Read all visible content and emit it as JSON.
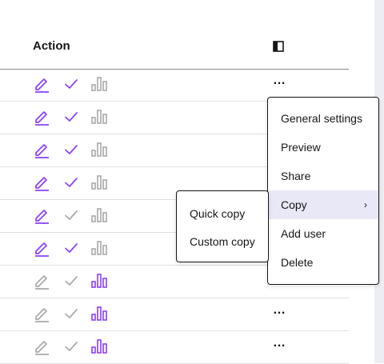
{
  "header": {
    "action_label": "Action"
  },
  "rows": [
    {
      "edit": "active",
      "check": "active",
      "chart": "inactive",
      "overflow": "…"
    },
    {
      "edit": "active",
      "check": "active",
      "chart": "inactive",
      "overflow": ""
    },
    {
      "edit": "active",
      "check": "active",
      "chart": "inactive",
      "overflow": ""
    },
    {
      "edit": "active",
      "check": "active",
      "chart": "inactive",
      "overflow": ""
    },
    {
      "edit": "active",
      "check": "inactive",
      "chart": "inactive",
      "overflow": ""
    },
    {
      "edit": "active",
      "check": "active",
      "chart": "inactive",
      "overflow": ""
    },
    {
      "edit": "inactive",
      "check": "inactive",
      "chart": "active",
      "overflow": ""
    },
    {
      "edit": "inactive",
      "check": "inactive",
      "chart": "active",
      "overflow": "…"
    },
    {
      "edit": "inactive",
      "check": "inactive",
      "chart": "active",
      "overflow": "…"
    }
  ],
  "overflow_menu": {
    "items": [
      {
        "label": "General settings"
      },
      {
        "label": "Preview"
      },
      {
        "label": "Share"
      },
      {
        "label": "Copy",
        "submenu_indicator": "›"
      },
      {
        "label": "Add user"
      },
      {
        "label": "Delete"
      }
    ]
  },
  "copy_submenu": {
    "items": [
      {
        "label": "Quick copy"
      },
      {
        "label": "Custom copy"
      }
    ]
  },
  "colors": {
    "accent": "#8a3ffc",
    "inactive": "#a8a8a8",
    "text": "#161616",
    "hover": "#e8e8f6"
  },
  "icons": {
    "edit": "edit-pencil-icon",
    "check": "checkmark-icon",
    "chart": "bar-chart-icon",
    "column_toggle": "column-toggle-icon",
    "overflow": "overflow-menu-icon"
  }
}
